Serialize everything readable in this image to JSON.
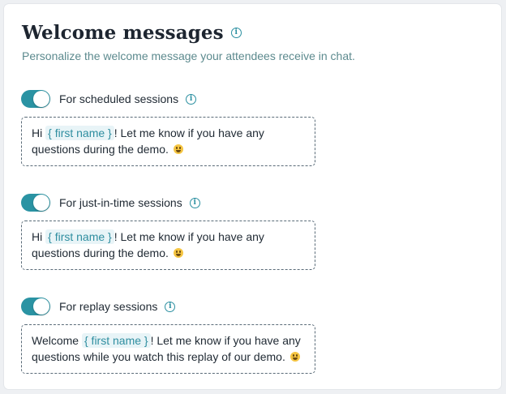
{
  "title": "Welcome messages",
  "subtitle": "Personalize the welcome message your attendees receive in chat.",
  "accent_color": "#2a93a3",
  "sections": [
    {
      "toggle_on": true,
      "label": "For scheduled sessions",
      "message": {
        "prefix": "Hi ",
        "token": "{ first name }",
        "suffix": "! Let me know if you have any questions during the demo. ",
        "emoji": "grinning-face"
      }
    },
    {
      "toggle_on": true,
      "label": "For just-in-time sessions",
      "message": {
        "prefix": "Hi ",
        "token": "{ first name }",
        "suffix": "! Let me know if you have any questions during the demo. ",
        "emoji": "grinning-face"
      }
    },
    {
      "toggle_on": true,
      "label": "For replay sessions",
      "message": {
        "prefix": "Welcome ",
        "token": "{ first name }",
        "suffix": "! Let me know if you have any questions while you watch this replay of our demo. ",
        "emoji": "grinning-face"
      }
    }
  ]
}
